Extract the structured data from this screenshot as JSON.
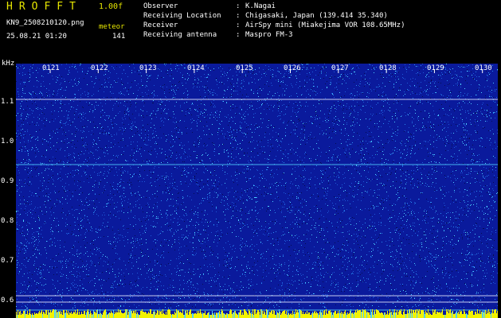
{
  "app": {
    "title": "HROFFT",
    "version": "1.00f",
    "filename": "KN9_2508210120.png",
    "meteor_label": "meteor",
    "meteor_count": "141",
    "datetime": "25.08.21 01:20"
  },
  "info": [
    {
      "label": "Observer",
      "value": "K.Nagai"
    },
    {
      "label": "Receiving Location",
      "value": "Chigasaki, Japan (139.414 35.340)"
    },
    {
      "label": "Receiver",
      "value": "AirSpy mini (Miakejima VOR 108.65MHz)"
    },
    {
      "label": "Receiving antenna",
      "value": "Maspro FM-3"
    }
  ],
  "separator": ":",
  "axis": {
    "unit": "kHz",
    "y_ticks": [
      "1.1",
      "1.0",
      "0.9",
      "0.8",
      "0.7",
      "0.6"
    ],
    "x_ticks": [
      "0121",
      "0122",
      "0123",
      "0124",
      "0125",
      "0126",
      "0127",
      "0128",
      "0129",
      "0130"
    ]
  },
  "colors": {
    "background": "#000000",
    "spectrogram_base": "#0a1a9c",
    "noise_light": "#4fd0ff",
    "noise_mid": "#1e5ad8",
    "noise_dark": "#050c50",
    "line_white": "#e8e8ff",
    "title_yellow": "#e6e600",
    "bottom_bar": "#f2f200"
  }
}
